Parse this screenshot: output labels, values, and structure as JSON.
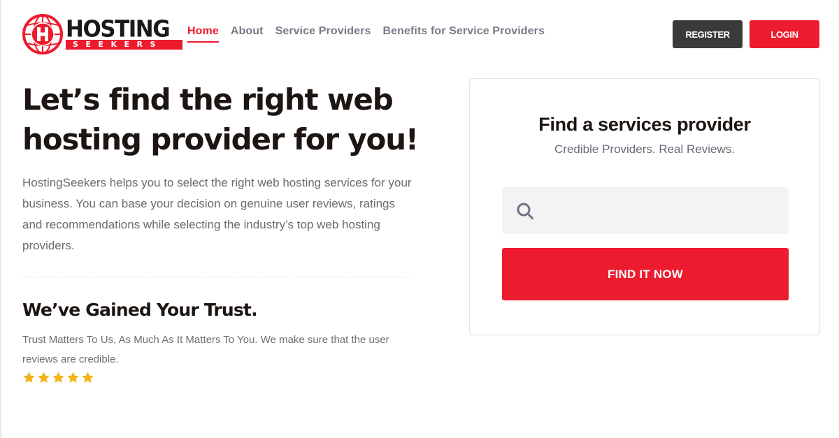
{
  "brand": {
    "name_top": "HOSTING",
    "name_bottom": "SEEKERS",
    "logo_letter": "H",
    "accent_color": "#ed1b2e"
  },
  "nav": {
    "items": [
      {
        "label": "Home",
        "active": true
      },
      {
        "label": "About",
        "active": false
      },
      {
        "label": "Service Providers",
        "active": false
      },
      {
        "label": "Benefits for Service Providers",
        "active": false
      }
    ]
  },
  "header_actions": {
    "register_label": "REGISTER",
    "login_label": "LOGIN"
  },
  "hero": {
    "title": "Let’s find the right web hosting provider for you!",
    "description": "HostingSeekers helps you to select the right web hosting services for your business. You can base your decision on genuine user reviews, ratings and recommendations while selecting the industry’s top web hosting providers."
  },
  "trust": {
    "title": "We’ve Gained Your Trust.",
    "description": "Trust Matters To Us, As Much As It Matters To You. We make sure that the user reviews are credible.",
    "rating": 5,
    "rating_max": 5,
    "star_color": "#f5b31a"
  },
  "search_card": {
    "title": "Find a services provider",
    "subtitle": "Credible Providers. Real Reviews.",
    "search_value": "",
    "search_placeholder": "",
    "button_label": "FIND IT NOW",
    "icon": "search-icon"
  }
}
